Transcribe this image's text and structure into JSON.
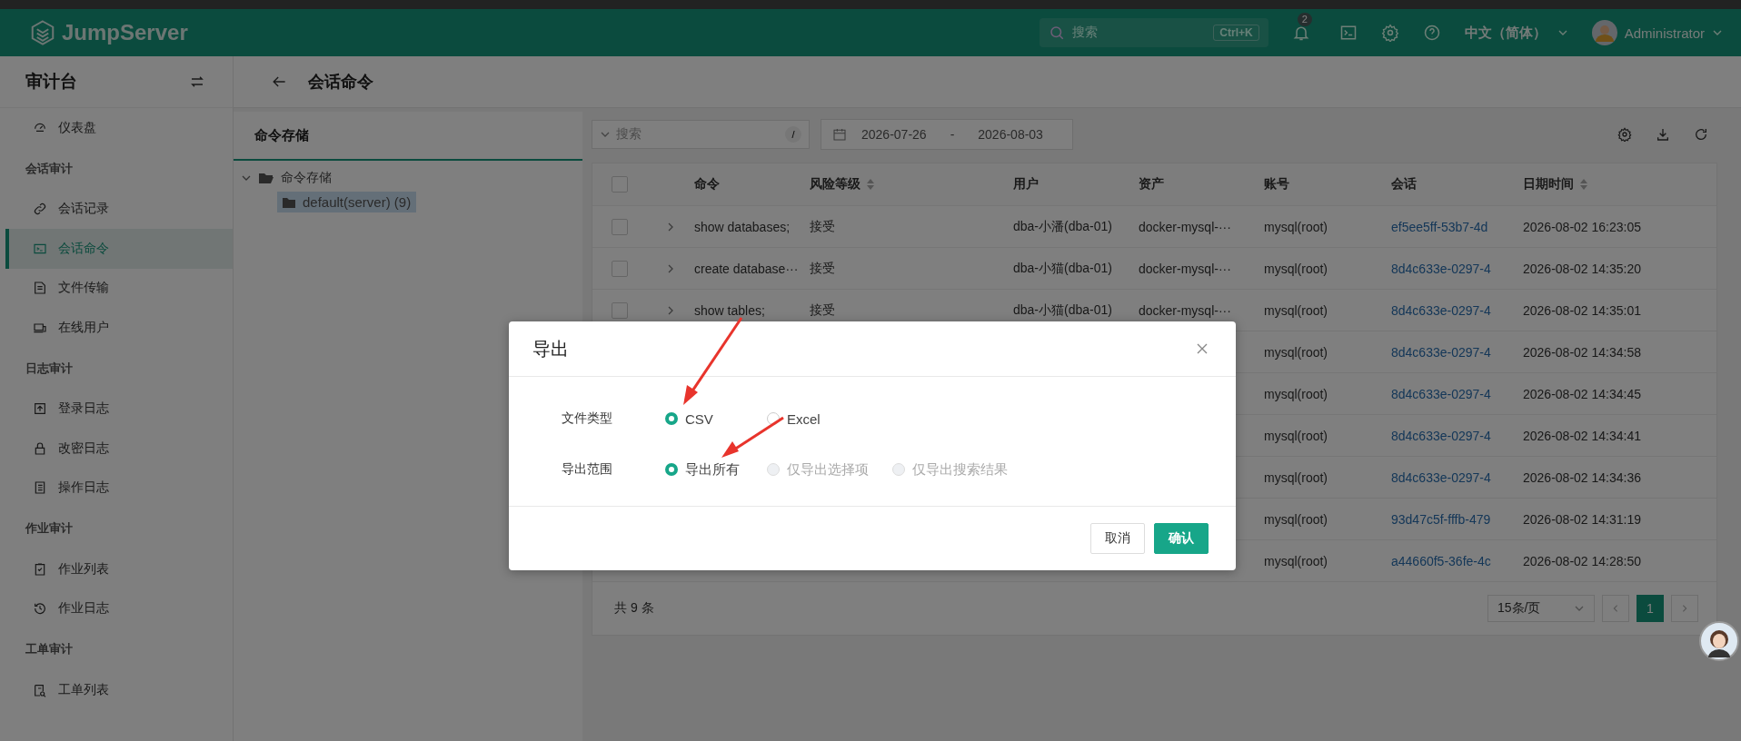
{
  "header": {
    "logo": "JumpServer",
    "search": {
      "placeholder": "搜索",
      "shortcut": "Ctrl+K"
    },
    "notifications": "2",
    "language": "中文（简体）",
    "user": "Administrator"
  },
  "sidebar": {
    "title": "审计台",
    "sections": [
      {
        "items": [
          {
            "label": "仪表盘",
            "selected": false
          }
        ]
      },
      {
        "title": "会话审计",
        "items": [
          {
            "label": "会话记录",
            "selected": false
          },
          {
            "label": "会话命令",
            "selected": true
          },
          {
            "label": "文件传输",
            "selected": false
          },
          {
            "label": "在线用户",
            "selected": false
          }
        ]
      },
      {
        "title": "日志审计",
        "items": [
          {
            "label": "登录日志",
            "selected": false
          },
          {
            "label": "改密日志",
            "selected": false
          },
          {
            "label": "操作日志",
            "selected": false
          }
        ]
      },
      {
        "title": "作业审计",
        "items": [
          {
            "label": "作业列表",
            "selected": false
          },
          {
            "label": "作业日志",
            "selected": false
          }
        ]
      },
      {
        "title": "工单审计",
        "items": [
          {
            "label": "工单列表",
            "selected": false
          }
        ]
      }
    ]
  },
  "page": {
    "title": "会话命令"
  },
  "tree": {
    "tab": "命令存储",
    "root": {
      "label": "命令存储",
      "expanded": true,
      "children": [
        {
          "label": "default(server) (9)",
          "selected": true
        }
      ]
    }
  },
  "toolbar": {
    "search": {
      "placeholder": "搜索",
      "shortcut": "/"
    },
    "date_from": "2026-07-26",
    "date_separator": "-",
    "date_to": "2026-08-03"
  },
  "table": {
    "select_all_checked": false,
    "columns": [
      {
        "label": "命令",
        "sortable": false
      },
      {
        "label": "风险等级",
        "sortable": true
      },
      {
        "label": "用户",
        "sortable": false
      },
      {
        "label": "资产",
        "sortable": false
      },
      {
        "label": "账号",
        "sortable": false
      },
      {
        "label": "会话",
        "sortable": false
      },
      {
        "label": "日期时间",
        "sortable": true
      }
    ],
    "rows": [
      {
        "checked": false,
        "command": "show databases;",
        "risk": "接受",
        "user": "dba-小潘(dba-01)",
        "asset": "docker-mysql-···",
        "account": "mysql(root)",
        "session": "ef5ee5ff-53b7-4d",
        "datetime": "2026-08-02 16:23:05"
      },
      {
        "checked": false,
        "command": "create database···",
        "risk": "接受",
        "user": "dba-小猫(dba-01)",
        "asset": "docker-mysql-···",
        "account": "mysql(root)",
        "session": "8d4c633e-0297-4",
        "datetime": "2026-08-02 14:35:20"
      },
      {
        "checked": false,
        "command": "show tables;",
        "risk": "接受",
        "user": "dba-小猫(dba-01)",
        "asset": "docker-mysql-···",
        "account": "mysql(root)",
        "session": "8d4c633e-0297-4",
        "datetime": "2026-08-02 14:35:01"
      },
      {
        "account": "mysql(root)",
        "session": "8d4c633e-0297-4",
        "datetime": "2026-08-02 14:34:58"
      },
      {
        "account": "mysql(root)",
        "session": "8d4c633e-0297-4",
        "datetime": "2026-08-02 14:34:45"
      },
      {
        "account": "mysql(root)",
        "session": "8d4c633e-0297-4",
        "datetime": "2026-08-02 14:34:41"
      },
      {
        "account": "mysql(root)",
        "session": "8d4c633e-0297-4",
        "datetime": "2026-08-02 14:34:36"
      },
      {
        "account": "mysql(root)",
        "session": "93d47c5f-fffb-479",
        "datetime": "2026-08-02 14:31:19"
      },
      {
        "account": "mysql(root)",
        "session": "a44660f5-36fe-4c",
        "datetime": "2026-08-02 14:28:50"
      }
    ]
  },
  "footer": {
    "total": "共 9 条",
    "page_size": "15条/页",
    "pages": [
      {
        "label": "1",
        "selected": true
      }
    ]
  },
  "dialog": {
    "title": "导出",
    "fields": [
      {
        "label": "文件类型",
        "options": [
          {
            "label": "CSV",
            "selected": true,
            "disabled": false
          },
          {
            "label": "Excel",
            "selected": false,
            "disabled": false
          }
        ]
      },
      {
        "label": "导出范围",
        "options": [
          {
            "label": "导出所有",
            "selected": true,
            "disabled": false
          },
          {
            "label": "仅导出选择项",
            "selected": false,
            "disabled": true
          },
          {
            "label": "仅导出搜索结果",
            "selected": false,
            "disabled": true
          }
        ]
      }
    ],
    "buttons": [
      {
        "label": "取消",
        "kind": "default"
      },
      {
        "label": "确认",
        "kind": "primary"
      }
    ]
  }
}
